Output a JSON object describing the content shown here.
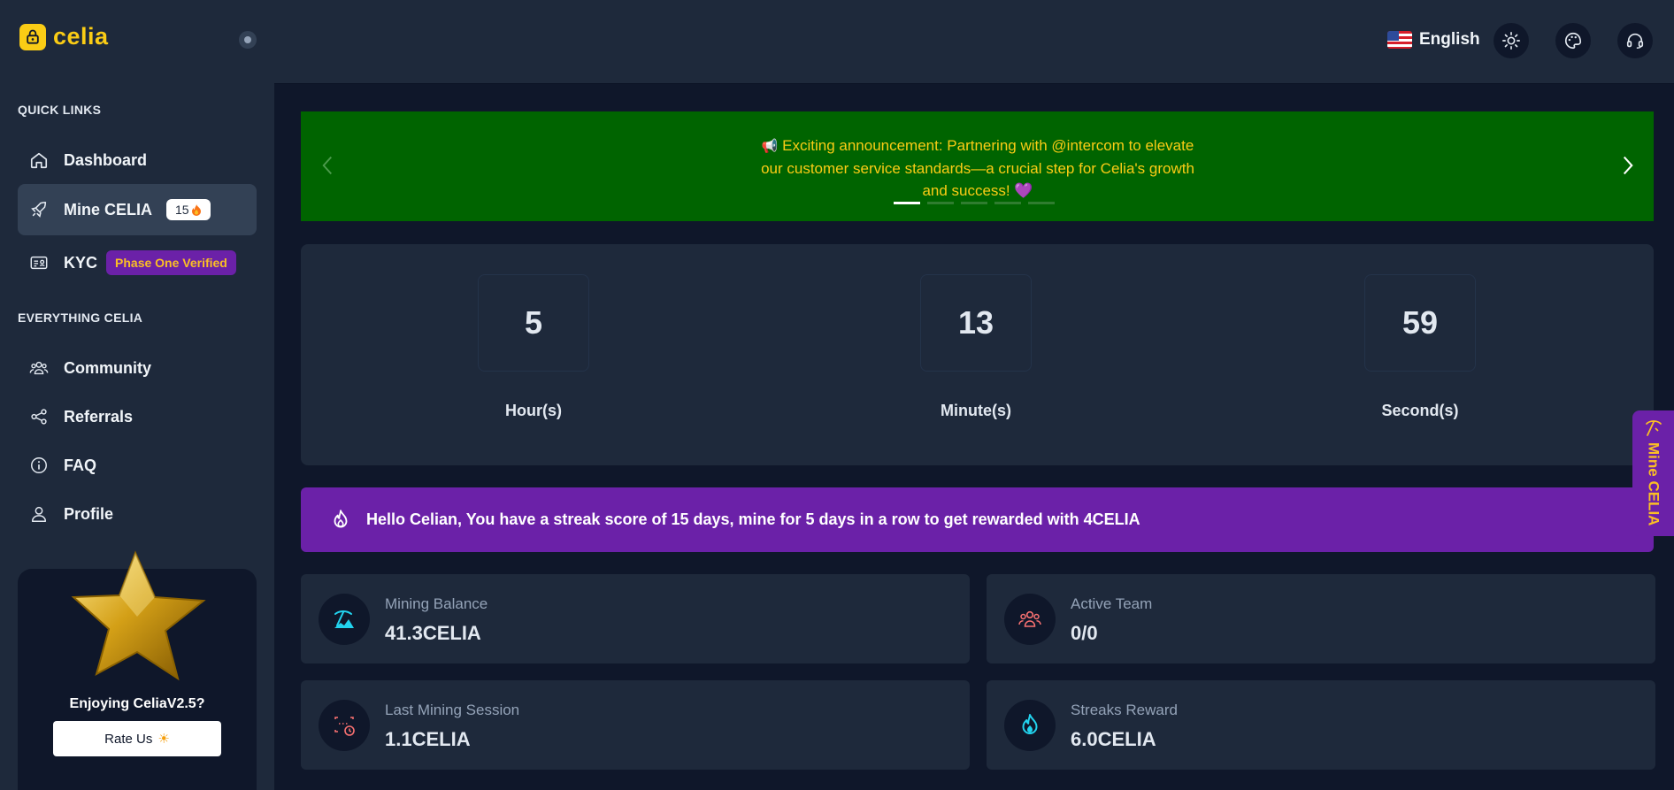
{
  "brand": {
    "name": "celia"
  },
  "sidebar": {
    "quick_links_title": "QUICK LINKS",
    "everything_title": "EVERYTHING CELIA",
    "items": [
      {
        "label": "Dashboard",
        "icon": "home-icon"
      },
      {
        "label": "Mine CELIA",
        "icon": "rocket-icon",
        "badge": "15",
        "active": true
      },
      {
        "label": "KYC",
        "icon": "id-card-icon",
        "badge": "Phase One Verified"
      },
      {
        "label": "Community",
        "icon": "users-icon"
      },
      {
        "label": "Referrals",
        "icon": "share-icon"
      },
      {
        "label": "FAQ",
        "icon": "info-icon"
      },
      {
        "label": "Profile",
        "icon": "user-icon"
      }
    ],
    "rate_card": {
      "title": "Enjoying CeliaV2.5?",
      "button": "Rate Us"
    }
  },
  "topbar": {
    "language": "English"
  },
  "banner": {
    "text": "Exciting announcement: Partnering with @intercom to elevate our customer service standards—a crucial step for Celia's growth and success! 💜",
    "slides": 5,
    "active_slide": 0
  },
  "countdown": {
    "hours": "5",
    "minutes": "13",
    "seconds": "59",
    "hours_label": "Hour(s)",
    "minutes_label": "Minute(s)",
    "seconds_label": "Second(s)"
  },
  "streak": {
    "message": "Hello Celian, You have a streak score of 15 days, mine for 5 days in a row to get rewarded with 4CELIA"
  },
  "side_tab": {
    "label": "Mine CELIA"
  },
  "stats": [
    {
      "label": "Mining Balance",
      "value": "41.3CELIA",
      "icon": "mining-icon",
      "color": "#22d3ee"
    },
    {
      "label": "Active Team",
      "value": "0/0",
      "icon": "team-icon",
      "color": "#f87171"
    },
    {
      "label": "Last Mining Session",
      "value": "1.1CELIA",
      "icon": "calendar-clock-icon",
      "color": "#f87171"
    },
    {
      "label": "Streaks Reward",
      "value": "6.0CELIA",
      "icon": "flame-icon",
      "color": "#22d3ee"
    }
  ]
}
